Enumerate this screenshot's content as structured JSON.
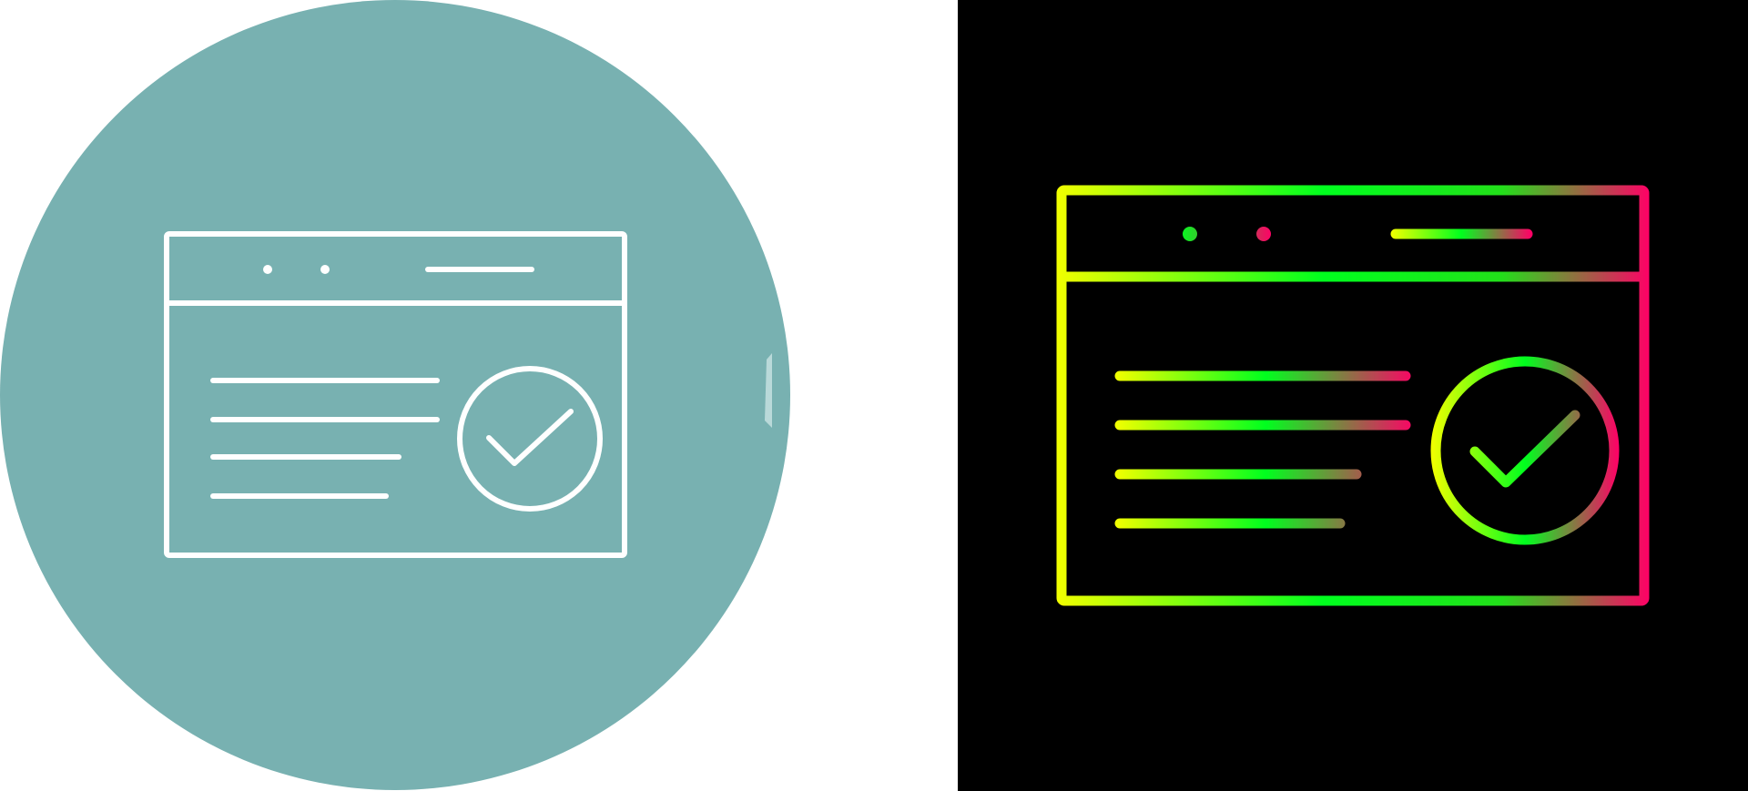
{
  "colors": {
    "left_background": "#ffffff",
    "circle_fill": "#78b1b1",
    "left_stroke": "#ffffff",
    "right_background": "#000000",
    "gradient_yellow": "#f2ff00",
    "gradient_green": "#00ff1e",
    "gradient_pink": "#ff0066"
  },
  "icons": {
    "left": "browser-window-check-icon",
    "right": "browser-window-check-icon"
  }
}
